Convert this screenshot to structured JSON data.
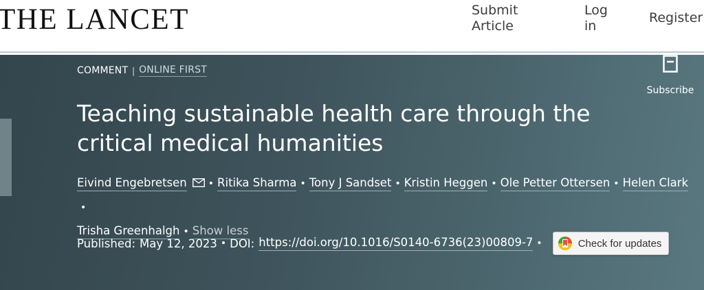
{
  "header": {
    "logo": "THE LANCET",
    "nav": {
      "submit": "Submit\nArticle",
      "login": "Log\nin",
      "register": "Register"
    }
  },
  "hero": {
    "article_type": "COMMENT",
    "separator": "|",
    "status": "ONLINE FIRST",
    "subscribe_label": "Subscribe",
    "subscribe_icon": "bookmark-document-icon",
    "title": "Teaching sustainable health care through the critical medical humanities",
    "authors": [
      "Eivind Engebretsen",
      "Ritika Sharma",
      "Tony J Sandset",
      "Kristin Heggen",
      "Ole Petter Ottersen",
      "Helen Clark",
      "Trisha Greenhalgh"
    ],
    "corresponding_icon": "mail-icon",
    "show_less": "Show less",
    "published_label": "Published:",
    "published_date": "May 12, 2023",
    "doi_label": "DOI:",
    "doi": "https://doi.org/10.1016/S0140-6736(23)00809-7",
    "check_updates": "Check for updates",
    "bullet": "•"
  },
  "colors": {
    "banner": "#3e535b",
    "text": "#ffffff",
    "logo": "#111111"
  }
}
